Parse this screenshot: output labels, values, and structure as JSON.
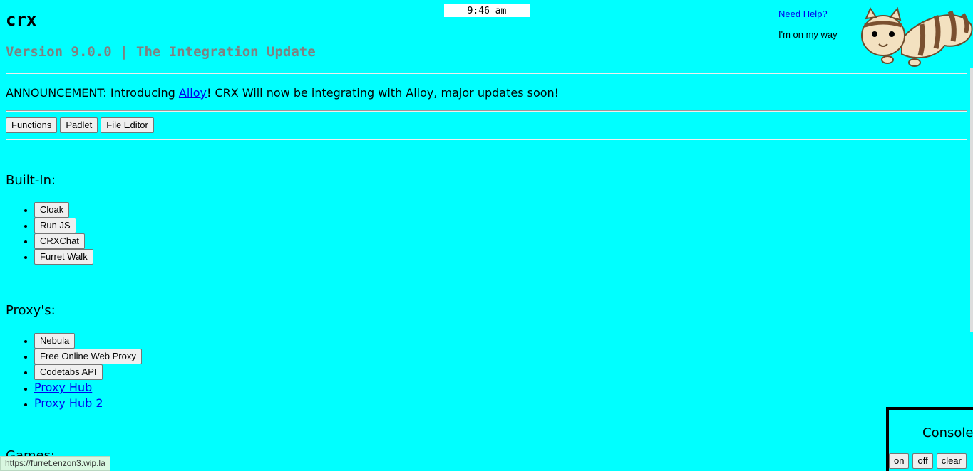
{
  "header": {
    "title": "crx",
    "version": "Version 9.0.0 | The Integration Update",
    "clock": "9:46 am",
    "help_link": "Need Help?",
    "status": "I'm on my way"
  },
  "announcement": {
    "prefix": "ANNOUNCEMENT: Introducing ",
    "link": "Alloy",
    "suffix": "! CRX Will now be integrating with Alloy, major updates soon!"
  },
  "tabs": [
    "Functions",
    "Padlet",
    "File Editor"
  ],
  "sections": {
    "builtin": {
      "heading": "Built-In:",
      "items": [
        "Cloak",
        "Run JS",
        "CRXChat",
        "Furret Walk"
      ]
    },
    "proxies": {
      "heading": "Proxy's:",
      "buttons": [
        "Nebula",
        "Free Online Web Proxy",
        "Codetabs API"
      ],
      "links": [
        "Proxy Hub",
        "Proxy Hub 2"
      ]
    },
    "games": {
      "heading": "Games:"
    }
  },
  "console": {
    "title": "Console",
    "on": "on",
    "off": "off",
    "clear": "clear"
  },
  "statusbar": {
    "url": "https://furret.enzon3.wip.la"
  },
  "colors": {
    "background": "#00ffff",
    "link": "#0000ee",
    "version": "#808080"
  },
  "icons": {
    "mascot": "furret-mascot-icon"
  }
}
